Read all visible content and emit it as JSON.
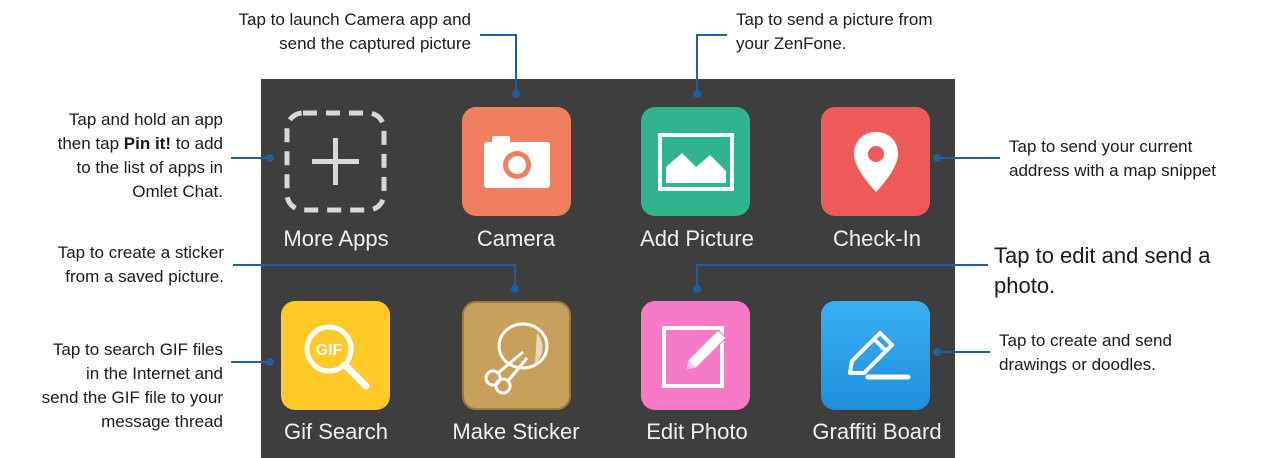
{
  "colors": {
    "panel": "#3e3e3e",
    "line": "#1f5fa0",
    "camera": "#f07f60",
    "add_picture": "#2fb48c",
    "check_in": "#ee5a58",
    "gif_search": "#ffc928",
    "make_sticker": "#c8a05c",
    "edit_photo": "#f77ac7",
    "graffiti_board": "#2aa3ea"
  },
  "apps": [
    {
      "label": "More Apps",
      "icon": "plus-icon"
    },
    {
      "label": "Camera",
      "icon": "camera-icon"
    },
    {
      "label": "Add Picture",
      "icon": "picture-icon"
    },
    {
      "label": "Check-In",
      "icon": "map-pin-icon"
    },
    {
      "label": "Gif Search",
      "icon": "gif-search-icon"
    },
    {
      "label": "Make Sticker",
      "icon": "scissors-sticker-icon"
    },
    {
      "label": "Edit Photo",
      "icon": "pencil-edit-icon"
    },
    {
      "label": "Graffiti Board",
      "icon": "pen-draw-icon"
    }
  ],
  "callouts": {
    "camera": {
      "line1": "Tap to launch Camera app and",
      "line2": "send the captured picture"
    },
    "add_picture": {
      "line1": "Tap to send a picture from",
      "line2": "your ZenFone."
    },
    "more_apps": {
      "line1": "Tap and hold an app",
      "line2_pre": "then tap ",
      "line2_bold": "Pin it!",
      "line2_post": " to add",
      "line3": "to the list of apps in",
      "line4": "Omlet Chat."
    },
    "check_in": {
      "line1": "Tap to send your current",
      "line2": "address with a map snippet"
    },
    "make_sticker": {
      "line1": "Tap to create a sticker",
      "line2": "from a saved picture."
    },
    "edit_photo": {
      "line1": "Tap to edit and send a",
      "line2": "photo."
    },
    "gif_search": {
      "line1": "Tap to search GIF files",
      "line2": "in the Internet and",
      "line3": "send the GIF file to your",
      "line4": "message thread"
    },
    "graffiti_board": {
      "line1": "Tap to create and send",
      "line2": "drawings or doodles."
    }
  }
}
